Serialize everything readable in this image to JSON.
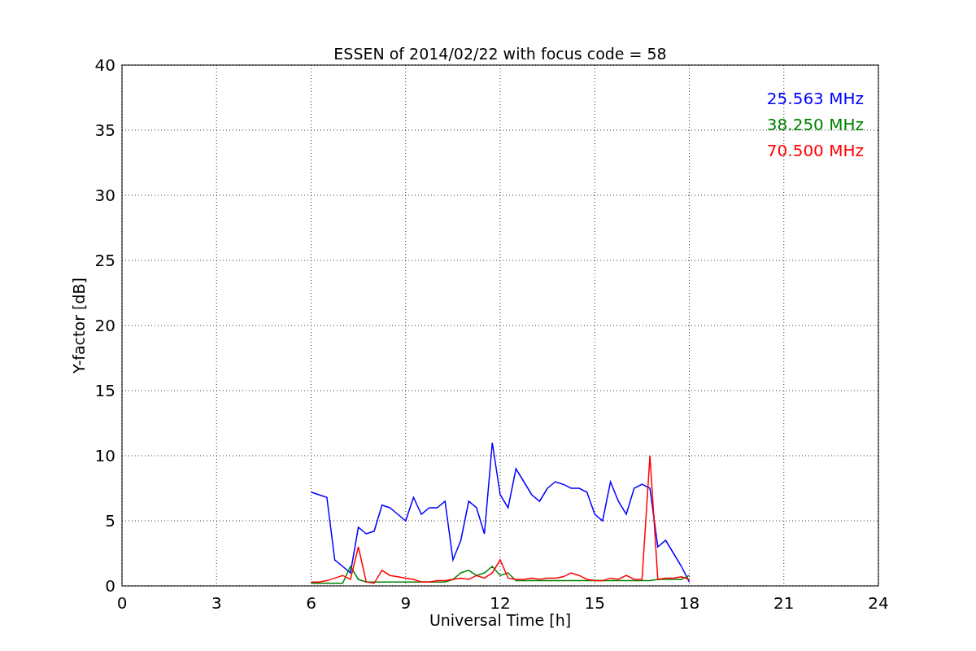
{
  "chart_data": {
    "type": "line",
    "title": "ESSEN of 2014/02/22 with focus code = 58",
    "xlabel": "Universal Time [h]",
    "ylabel": "Y-factor [dB]",
    "xlim": [
      0,
      24
    ],
    "ylim": [
      0,
      40
    ],
    "xticks": [
      0,
      3,
      6,
      9,
      12,
      15,
      18,
      21,
      24
    ],
    "yticks": [
      0,
      5,
      10,
      15,
      20,
      25,
      30,
      35,
      40
    ],
    "grid": true,
    "x": [
      6,
      6.25,
      6.5,
      6.75,
      7,
      7.25,
      7.5,
      7.75,
      8,
      8.25,
      8.5,
      8.75,
      9,
      9.25,
      9.5,
      9.75,
      10,
      10.25,
      10.5,
      10.75,
      11,
      11.25,
      11.5,
      11.75,
      12,
      12.25,
      12.5,
      12.75,
      13,
      13.25,
      13.5,
      13.75,
      14,
      14.25,
      14.5,
      14.75,
      15,
      15.25,
      15.5,
      15.75,
      16,
      16.25,
      16.5,
      16.75,
      17,
      17.25,
      17.5,
      17.75,
      18
    ],
    "series": [
      {
        "name": "25.563 MHz",
        "color": "#0000ff",
        "values": [
          7.2,
          7.0,
          6.8,
          2.0,
          1.5,
          1.0,
          4.5,
          4.0,
          4.2,
          6.2,
          6.0,
          5.5,
          5.0,
          6.8,
          5.5,
          6.0,
          6.0,
          6.5,
          2.0,
          3.5,
          6.5,
          6.0,
          4.0,
          11.0,
          7.0,
          6.0,
          9.0,
          8.0,
          7.0,
          6.5,
          7.5,
          8.0,
          7.8,
          7.5,
          7.5,
          7.2,
          5.5,
          5.0,
          8.0,
          6.5,
          5.5,
          7.5,
          7.8,
          7.5,
          3.0,
          3.5,
          2.5,
          1.5,
          0.3
        ]
      },
      {
        "name": "38.250 MHz",
        "color": "#008000",
        "values": [
          0.2,
          0.2,
          0.2,
          0.2,
          0.2,
          1.5,
          0.5,
          0.3,
          0.3,
          0.3,
          0.3,
          0.3,
          0.3,
          0.3,
          0.3,
          0.3,
          0.3,
          0.3,
          0.5,
          1.0,
          1.2,
          0.8,
          1.0,
          1.5,
          0.8,
          1.0,
          0.4,
          0.4,
          0.4,
          0.4,
          0.4,
          0.4,
          0.4,
          0.4,
          0.4,
          0.4,
          0.4,
          0.4,
          0.4,
          0.4,
          0.4,
          0.4,
          0.4,
          0.4,
          0.5,
          0.5,
          0.5,
          0.5,
          0.8
        ]
      },
      {
        "name": "70.500 MHz",
        "color": "#ff0000",
        "values": [
          0.3,
          0.3,
          0.4,
          0.6,
          0.8,
          0.5,
          3.0,
          0.3,
          0.2,
          1.2,
          0.8,
          0.7,
          0.6,
          0.5,
          0.3,
          0.3,
          0.4,
          0.4,
          0.5,
          0.6,
          0.5,
          0.8,
          0.6,
          1.0,
          2.0,
          0.6,
          0.5,
          0.5,
          0.6,
          0.5,
          0.6,
          0.6,
          0.7,
          1.0,
          0.8,
          0.5,
          0.4,
          0.4,
          0.6,
          0.5,
          0.8,
          0.5,
          0.5,
          10.0,
          0.5,
          0.6,
          0.6,
          0.7,
          0.5
        ]
      }
    ]
  }
}
